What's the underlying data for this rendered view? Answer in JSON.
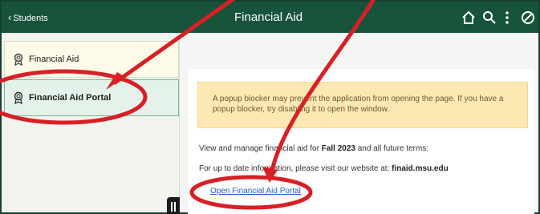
{
  "header": {
    "back_label": "Students",
    "title": "Financial Aid"
  },
  "sidebar": {
    "items": [
      {
        "label": "Financial Aid"
      },
      {
        "label": "Financial Aid Portal",
        "selected": true
      }
    ]
  },
  "main": {
    "warning_text": "A popup blocker may prevent the application from opening the page. If you have a popup blocker, try disabling it to open the window.",
    "para1_prefix": "View and manage financial aid for",
    "para1_term": "Fall 2023",
    "para1_suffix": "and all future terms:",
    "para2_prefix": "For up to date information, please visit our website at:",
    "para2_site": "finaid.msu.edu",
    "link_label": "Open Financial Aid Portal"
  },
  "colors": {
    "header_bg": "#17533b",
    "selected_item_bg": "#e4f2ea",
    "warning_bg": "#fde8b3",
    "annotation_red": "#d81f26"
  },
  "icons": [
    "chevron-left-icon",
    "home-icon",
    "search-icon",
    "more-vertical-icon",
    "navigation-icon",
    "award-icon",
    "collapse-handle-icon"
  ]
}
